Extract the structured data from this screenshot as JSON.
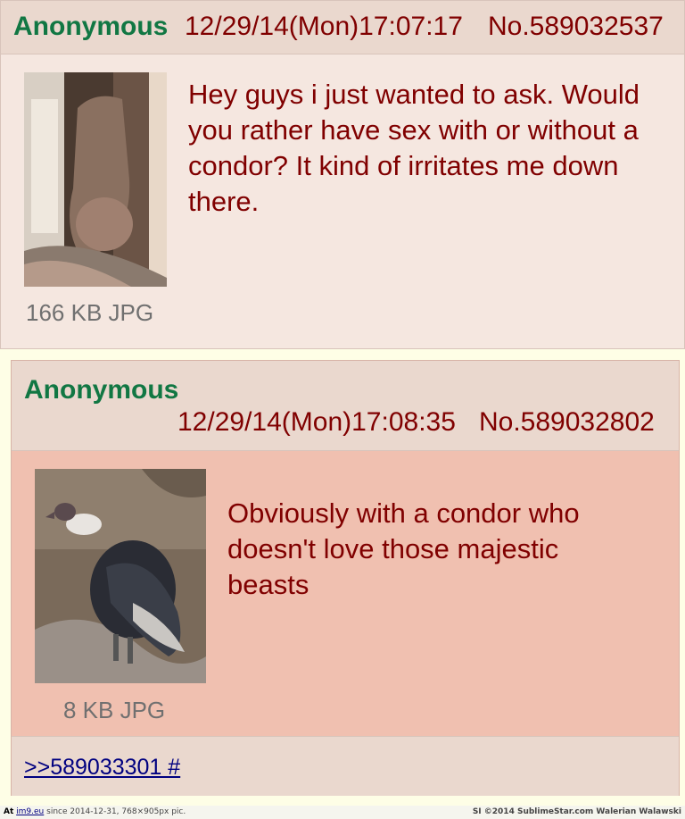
{
  "posts": [
    {
      "name": "Anonymous",
      "datetime": "12/29/14(Mon)17:07:17",
      "post_no": "No.589032537",
      "file_info": "166 KB JPG",
      "message": "Hey guys i just wanted to ask. Would you rather have sex with or without a condor? It kind of irritates me down there."
    },
    {
      "name": "Anonymous",
      "datetime": "12/29/14(Mon)17:08:35",
      "post_no": "No.589032802",
      "file_info": "8 KB JPG",
      "message": "Obviously with a condor who doesn't love those majestic beasts",
      "backlink": ">>589033301 #"
    }
  ],
  "footer": {
    "left_prefix": "At",
    "left_site": "im9.eu",
    "left_suffix": "since 2014-12-31, 768×905px pic.",
    "right": "SI ©2014 SublimeStar.com Walerian Walawski"
  },
  "colors": {
    "name": "#117743",
    "meta": "#800000",
    "post_bg": "#f5e7e0",
    "reply_highlight_bg": "#f0c0b0",
    "header_bg": "#ead8ce"
  }
}
